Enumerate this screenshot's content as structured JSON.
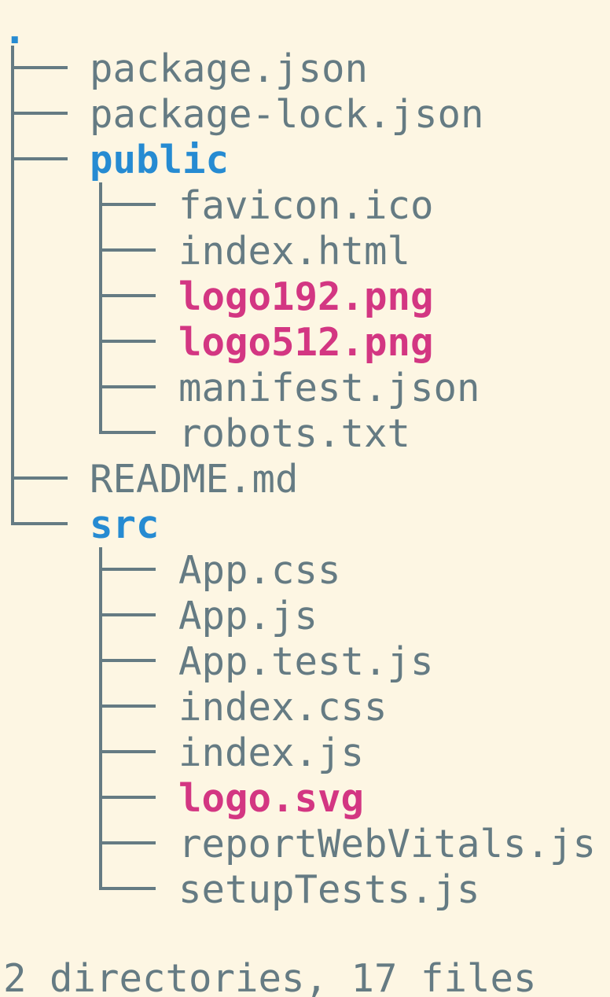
{
  "tree": {
    "root": ".",
    "items": [
      {
        "name": "package.json",
        "type": "file"
      },
      {
        "name": "package-lock.json",
        "type": "file"
      },
      {
        "name": "public",
        "type": "directory"
      },
      {
        "name": "favicon.ico",
        "type": "file"
      },
      {
        "name": "index.html",
        "type": "file"
      },
      {
        "name": "logo192.png",
        "type": "image"
      },
      {
        "name": "logo512.png",
        "type": "image"
      },
      {
        "name": "manifest.json",
        "type": "file"
      },
      {
        "name": "robots.txt",
        "type": "file"
      },
      {
        "name": "README.md",
        "type": "file"
      },
      {
        "name": "src",
        "type": "directory"
      },
      {
        "name": "App.css",
        "type": "file"
      },
      {
        "name": "App.js",
        "type": "file"
      },
      {
        "name": "App.test.js",
        "type": "file"
      },
      {
        "name": "index.css",
        "type": "file"
      },
      {
        "name": "index.js",
        "type": "file"
      },
      {
        "name": "logo.svg",
        "type": "image"
      },
      {
        "name": "reportWebVitals.js",
        "type": "file"
      },
      {
        "name": "setupTests.js",
        "type": "file"
      }
    ]
  },
  "summary": "2 directories, 17 files",
  "colors": {
    "background": "#fdf6e3",
    "text": "#657b83",
    "directory": "#268bd2",
    "image": "#d33682"
  }
}
